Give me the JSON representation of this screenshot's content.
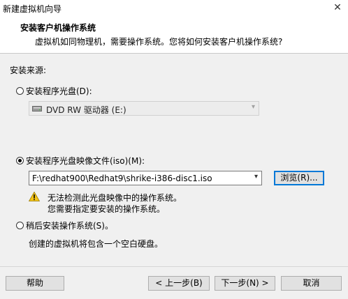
{
  "window": {
    "title": "新建虚拟机向导",
    "close_glyph": "✕"
  },
  "header": {
    "title": "安装客户机操作系统",
    "subtitle": "虚拟机如同物理机，需要操作系统。您将如何安装客户机操作系统?"
  },
  "install_source": {
    "label": "安装来源:",
    "disc_option": {
      "label": "安装程序光盘(D):",
      "selected": false
    },
    "disc_drive": {
      "value": "DVD RW 驱动器 (E:)",
      "icon": "dvd-drive-icon"
    },
    "iso_option": {
      "label": "安装程序光盘映像文件(iso)(M):",
      "selected": true
    },
    "iso_path": {
      "value": "F:\\redhat900\\Redhat9\\shrike-i386-disc1.iso"
    },
    "browse_label": "浏览(R)...",
    "warning": {
      "icon": "warning-icon",
      "line1": "无法检测此光盘映像中的操作系统。",
      "line2": "您需要指定要安装的操作系统。"
    },
    "later_option": {
      "label": "稍后安装操作系统(S)。",
      "selected": false
    },
    "later_note": "创建的虚拟机将包含一个空白硬盘。"
  },
  "footer": {
    "help_label": "帮助",
    "back_label": "< 上一步(B)",
    "next_label": "下一步(N) >",
    "cancel_label": "取消"
  },
  "colors": {
    "accent": "#0078d7",
    "warning": "#f5c518"
  }
}
